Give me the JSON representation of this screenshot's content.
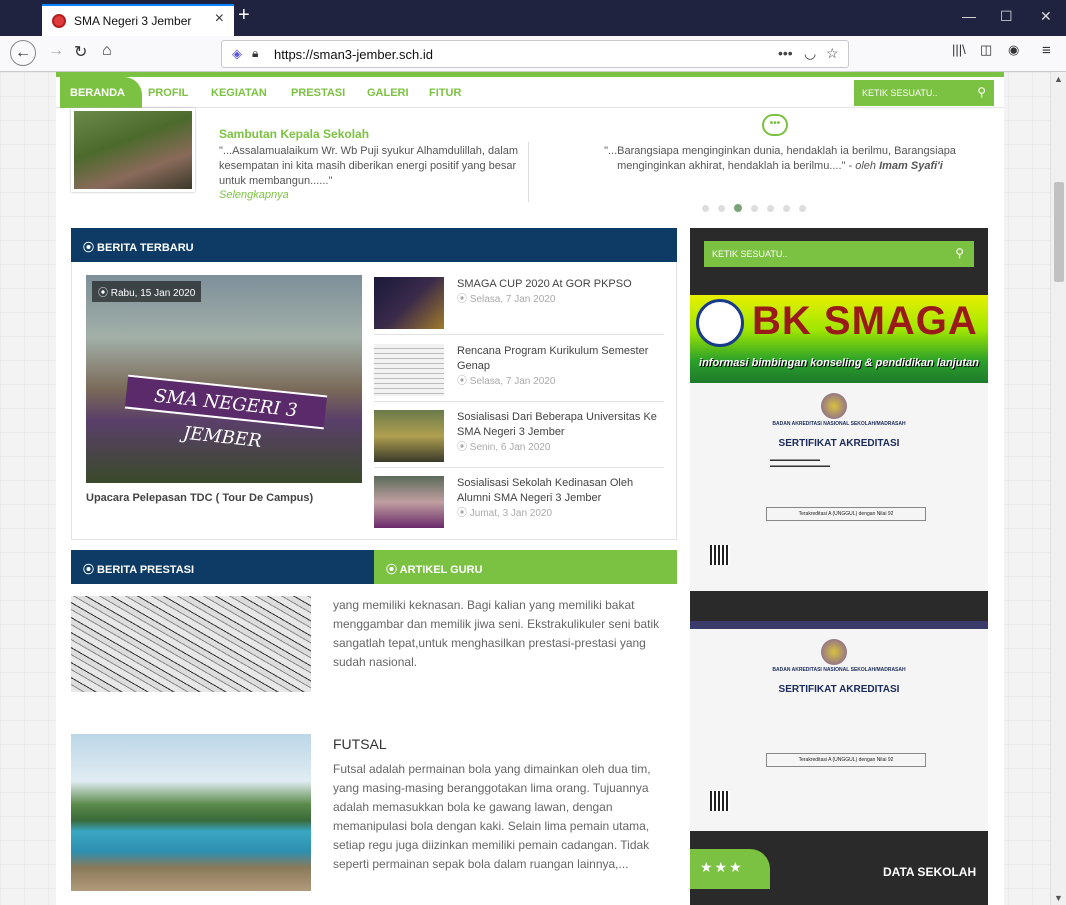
{
  "browser": {
    "tab_title": "SMA Negeri 3 Jember",
    "url": "https://sman3-jember.sch.id",
    "url_more": "•••"
  },
  "nav": {
    "items": [
      "BERANDA",
      "PROFIL",
      "KEGIATAN",
      "PRESTASI",
      "GALERI",
      "FITUR"
    ],
    "search_placeholder": "KETIK SESUATU.."
  },
  "sambutan": {
    "title": "Sambutan Kepala Sekolah",
    "body": "\"...Assalamualaikum Wr. Wb Puji syukur Alhamdulillah, dalam kesempatan ini kita masih diberikan energi positif yang besar untuk membangun......\"",
    "link": "Selengkapnya"
  },
  "quote": {
    "text": "\"...Barangsiapa menginginkan dunia, hendaklah ia berilmu, Barangsiapa menginginkan akhirat, hendaklah ia berilmu....\" -",
    "by": "oleh",
    "author": "Imam Syafi'i",
    "dots_count": 7,
    "active_dot": 2
  },
  "berita_terbaru": {
    "header": "⦿ BERITA TERBARU",
    "main": {
      "date": "⦿ Rabu, 15 Jan 2020",
      "title": "Upacara Pelepasan TDC ( Tour De Campus)",
      "banner": "SMA NEGERI 3 JEMBER"
    },
    "items": [
      {
        "title": "SMAGA CUP 2020 At GOR PKPSO",
        "date": "⦿ Selasa, 7 Jan 2020"
      },
      {
        "title": "Rencana Program Kurikulum Semester Genap",
        "date": "⦿ Selasa, 7 Jan 2020"
      },
      {
        "title": "Sosialisasi Dari Beberapa Universitas Ke SMA Negeri 3 Jember",
        "date": "⦿ Senin, 6 Jan 2020"
      },
      {
        "title": "Sosialisasi Sekolah Kedinasan Oleh Alumni SMA Negeri 3 Jember",
        "date": "⦿ Jumat, 3 Jan 2020"
      }
    ]
  },
  "sidebar": {
    "search_placeholder": "KETIK SESUATU..",
    "bk_title": "BK SMAGA",
    "bk_subtitle": "informasi bimbingan konseling & pendidikan lanjutan",
    "cert": {
      "org": "BADAN AKREDITASI NASIONAL SEKOLAH/MADRASAH",
      "title": "SERTIFIKAT AKREDITASI",
      "grade": "Terakreditasi A (UNGGUL) dengan Nilai 92"
    },
    "data_sekolah": "DATA SEKOLAH",
    "stars": "★★★"
  },
  "berita_prestasi": {
    "header": "⦿ BERITA PRESTASI"
  },
  "artikel_guru": {
    "header": "⦿ ARTIKEL GURU"
  },
  "batik": {
    "text": "yang memiliki keknasan. Bagi kalian yang memiliki bakat menggambar dan memilik jiwa seni. Ekstrakulikuler seni batik sangatlah tepat,untuk menghasilkan prestasi-prestasi yang sudah nasional."
  },
  "futsal": {
    "title": "FUTSAL",
    "text": "Futsal adalah permainan bola yang dimainkan oleh dua tim, yang masing-masing beranggotakan lima orang. Tujuannya adalah memasukkan bola ke gawang lawan, dengan memanipulasi bola dengan kaki. Selain lima pemain utama, setiap regu juga diizinkan memiliki pemain cadangan. Tidak seperti permainan sepak bola dalam ruangan lainnya,..."
  },
  "colors": {
    "accent_green": "#7cc242",
    "navy": "#0d3b66",
    "chrome_dark": "#202340"
  }
}
